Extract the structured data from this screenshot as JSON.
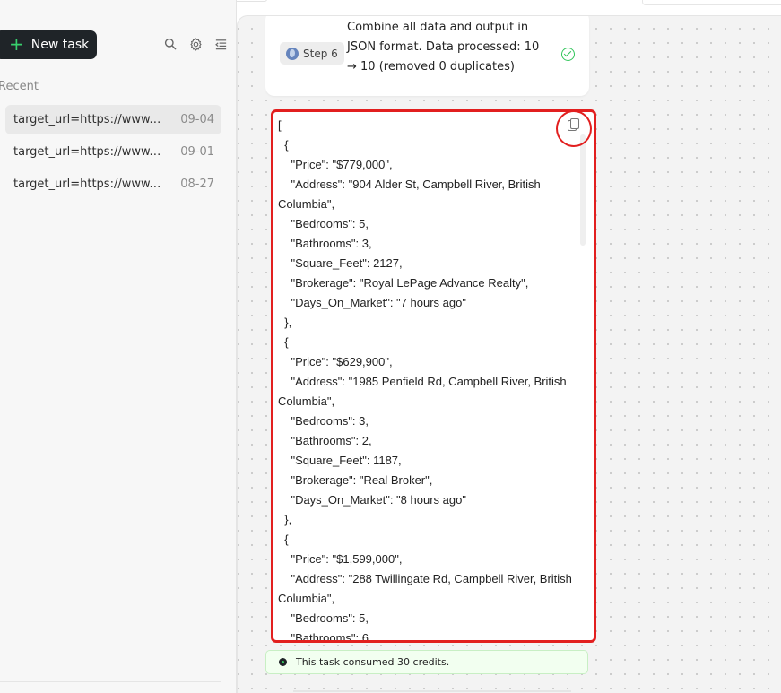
{
  "sidebar": {
    "new_task_label": "New task",
    "recent_label": "Recent",
    "recent_items": [
      {
        "url": "target_url=https://www.realtor.ca/bc/campbell-river/real-estate",
        "date": "09-04"
      },
      {
        "url": "target_url=https://www.realtor.ca/bc/campbell-river/real-estate",
        "date": "09-01"
      },
      {
        "url": "target_url=https://www.realtor.ca/bc/campbell-river/real-estate",
        "date": "08-27"
      }
    ]
  },
  "main": {
    "step": {
      "badge_label": "Step 6",
      "text": "Combine all data and output in JSON format. Data processed: 10 → 10 (removed 0 duplicates)"
    },
    "json_output": "[\n  {\n    \"Price\": \"$779,000\",\n    \"Address\": \"904 Alder St, Campbell River, British Columbia\",\n    \"Bedrooms\": 5,\n    \"Bathrooms\": 3,\n    \"Square_Feet\": 2127,\n    \"Brokerage\": \"Royal LePage Advance Realty\",\n    \"Days_On_Market\": \"7 hours ago\"\n  },\n  {\n    \"Price\": \"$629,900\",\n    \"Address\": \"1985 Penfield Rd, Campbell River, British Columbia\",\n    \"Bedrooms\": 3,\n    \"Bathrooms\": 2,\n    \"Square_Feet\": 1187,\n    \"Brokerage\": \"Real Broker\",\n    \"Days_On_Market\": \"8 hours ago\"\n  },\n  {\n    \"Price\": \"$1,599,000\",\n    \"Address\": \"288 Twillingate Rd, Campbell River, British Columbia\",\n    \"Bedrooms\": 5,\n    \"Bathrooms\": 6,",
    "credits_text": "This task consumed 30 credits."
  },
  "icons": {
    "search": "search-icon",
    "settings": "gear-icon",
    "collapse": "sidebar-collapse-icon",
    "globe": "globe-icon",
    "check": "check-circle-icon",
    "copy": "copy-icon",
    "credits": "credit-dot-icon"
  },
  "colors": {
    "new_task_bg": "#1f2428",
    "new_task_plus": "#38d06d",
    "highlight_red": "#e21f1f",
    "success_green": "#31c55a",
    "credits_bg": "#f2fff0"
  }
}
